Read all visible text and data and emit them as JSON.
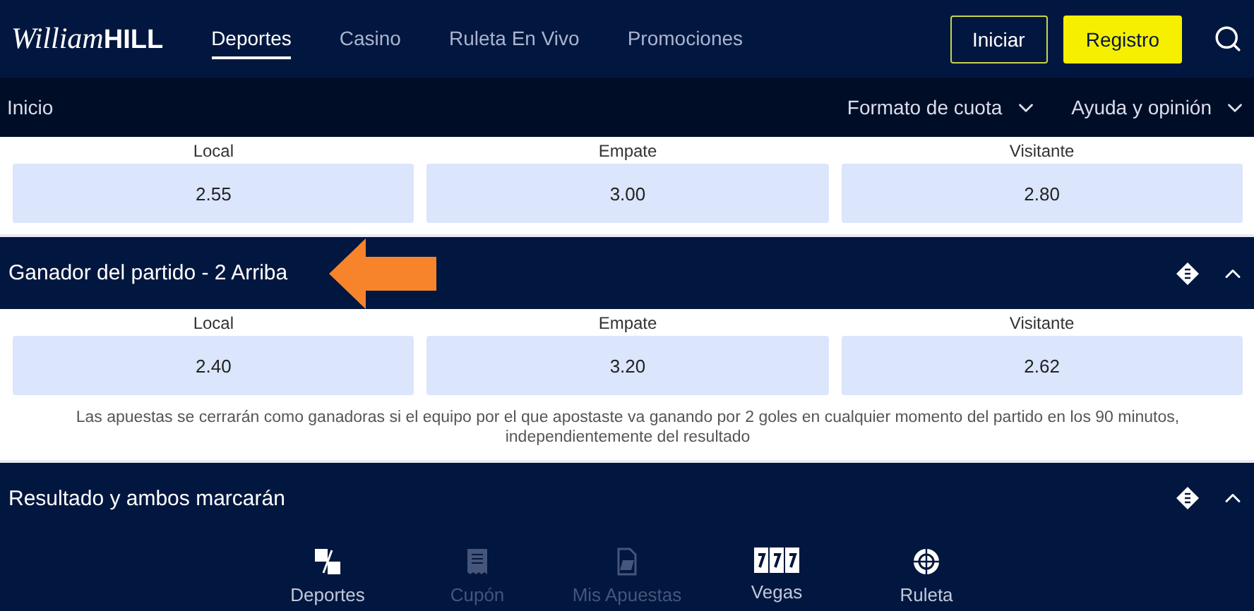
{
  "logo": {
    "script": "William",
    "bold": "HILL"
  },
  "nav": [
    {
      "label": "Deportes",
      "selected": true
    },
    {
      "label": "Casino",
      "selected": false
    },
    {
      "label": "Ruleta En Vivo",
      "selected": false
    },
    {
      "label": "Promociones",
      "selected": false
    }
  ],
  "actions": {
    "login": "Iniciar",
    "register": "Registro"
  },
  "subbar": {
    "breadcrumb": "Inicio",
    "menus": [
      "Formato de cuota",
      "Ayuda y opinión"
    ]
  },
  "sections": [
    {
      "kind": "odds",
      "outcomes": [
        {
          "label": "Local",
          "price": "2.55"
        },
        {
          "label": "Empate",
          "price": "3.00"
        },
        {
          "label": "Visitante",
          "price": "2.80"
        }
      ]
    },
    {
      "kind": "header",
      "title": "Ganador del partido - 2 Arriba",
      "expanded": true,
      "pointer": true
    },
    {
      "kind": "odds",
      "outcomes": [
        {
          "label": "Local",
          "price": "2.40"
        },
        {
          "label": "Empate",
          "price": "3.20"
        },
        {
          "label": "Visitante",
          "price": "2.62"
        }
      ],
      "note": "Las apuestas se cerrarán como ganadoras si el equipo por el que apostaste va ganando por 2 goles en cualquier momento del partido en los 90 minutos, independientemente del resultado"
    },
    {
      "kind": "header",
      "title": "Resultado y ambos marcarán",
      "expanded": true,
      "pointer": false
    }
  ],
  "bottom_nav": [
    {
      "label": "Deportes",
      "kind": "az",
      "disabled": false
    },
    {
      "label": "Cupón",
      "kind": "slip",
      "disabled": true
    },
    {
      "label": "Mis Apuestas",
      "kind": "bets",
      "disabled": true
    },
    {
      "label": "Vegas",
      "kind": "slots",
      "disabled": false
    },
    {
      "label": "Ruleta",
      "kind": "wheel",
      "disabled": false
    }
  ]
}
